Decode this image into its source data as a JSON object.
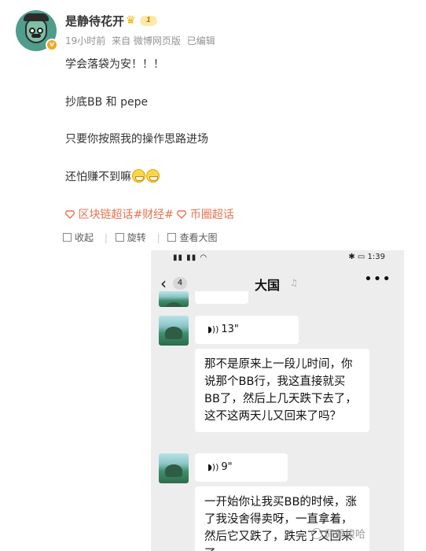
{
  "post": {
    "username": "是静待花开",
    "level": "1",
    "meta": {
      "time": "19小时前",
      "source": "来自 微博网页版",
      "edited": "已编辑"
    },
    "content_lines": [
      "学会落袋为安！！！",
      "抄底BB  和 pepe",
      "只要你按照我的操作思路进场",
      "还怕赚不到嘛"
    ],
    "tags": [
      "区块链超话",
      "#财经#",
      "币圈超话"
    ],
    "toolbar": {
      "collapse": "收起",
      "rotate": "旋转",
      "view_large": "查看大图"
    }
  },
  "phone": {
    "status_time": "1:39",
    "unread_count": "4",
    "chat_title": "大国",
    "messages": [
      {
        "type": "voice",
        "duration": "13\""
      },
      {
        "type": "text",
        "text": "那不是原来上一段儿时间，你说那个BB行，我这直接就买BB了，然后上几天跌下去了，这不这两天儿又回来了吗？"
      },
      {
        "type": "voice",
        "duration": "9\""
      },
      {
        "type": "text",
        "text": "一开始你让我买BB的时候，涨了我没舍得卖呀，一直拿着，然后它又跌了，跌完了又回来了"
      }
    ]
  },
  "watermark": "佩佩梭哈",
  "colors": {
    "tag_orange": "#eb7350",
    "meta_gray": "#939393",
    "chat_bg": "#ededed"
  }
}
